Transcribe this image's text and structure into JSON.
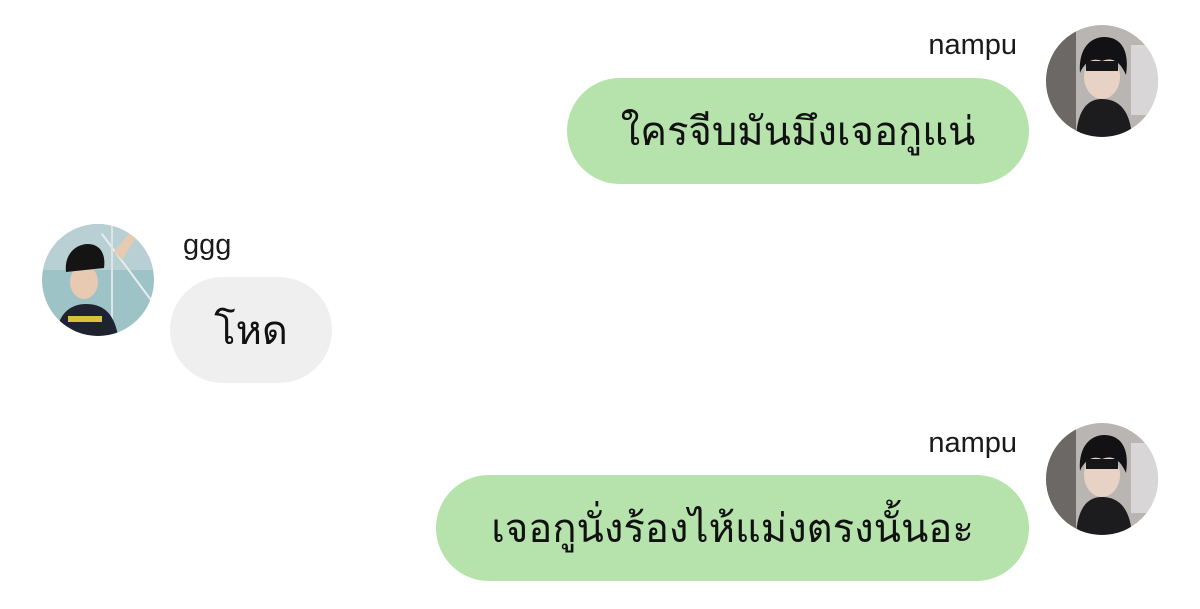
{
  "chat": {
    "messages": [
      {
        "sender": "nampu",
        "text": "ใครจีบมันมึงเจอกูแน่",
        "side": "outgoing"
      },
      {
        "sender": "ggg",
        "text": "โหด",
        "side": "incoming"
      },
      {
        "sender": "nampu",
        "text": "เจอกูนั่งร้องไห้แม่งตรงนั้นอะ",
        "side": "outgoing"
      }
    ]
  },
  "colors": {
    "outgoing_bubble": "#b5e3ab",
    "incoming_bubble": "#efefef",
    "background": "#ffffff"
  },
  "icons": {
    "avatar_nampu": "user-photo-avatar",
    "avatar_ggg": "user-photo-avatar"
  }
}
